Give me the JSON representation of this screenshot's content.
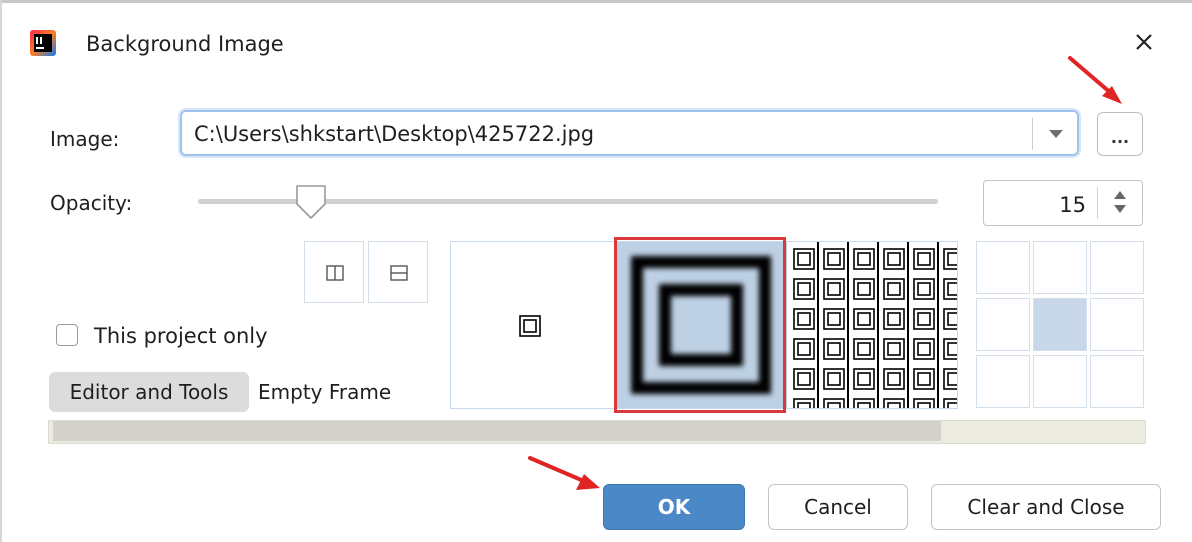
{
  "window": {
    "title": "Background Image",
    "app_icon": "intellij-idea-icon",
    "close_icon": "close-icon"
  },
  "image": {
    "label": "Image:",
    "path": "C:\\Users\\shkstart\\Desktop\\425722.jpg",
    "browse_label": "..."
  },
  "opacity": {
    "label": "Opacity:",
    "value": "15",
    "slider_percent": 15
  },
  "flip": {
    "horizontal_icon": "flip-horizontal-icon",
    "vertical_icon": "flip-vertical-icon"
  },
  "scope": {
    "checkbox_label": "This project only",
    "checked": false
  },
  "targets": {
    "tabs": [
      "Editor and Tools",
      "Empty Frame"
    ],
    "active": "Editor and Tools"
  },
  "fill": {
    "options": [
      "plain",
      "scale",
      "tile"
    ],
    "selected": "scale"
  },
  "anchor": {
    "selected": "center"
  },
  "buttons": {
    "ok": "OK",
    "cancel": "Cancel",
    "clear_close": "Clear and Close"
  },
  "colors": {
    "accent": "#4a88c8",
    "selection_outline": "#d9393a",
    "annotation_arrow": "#e02424",
    "preview_fill": "#c8d8ea"
  }
}
